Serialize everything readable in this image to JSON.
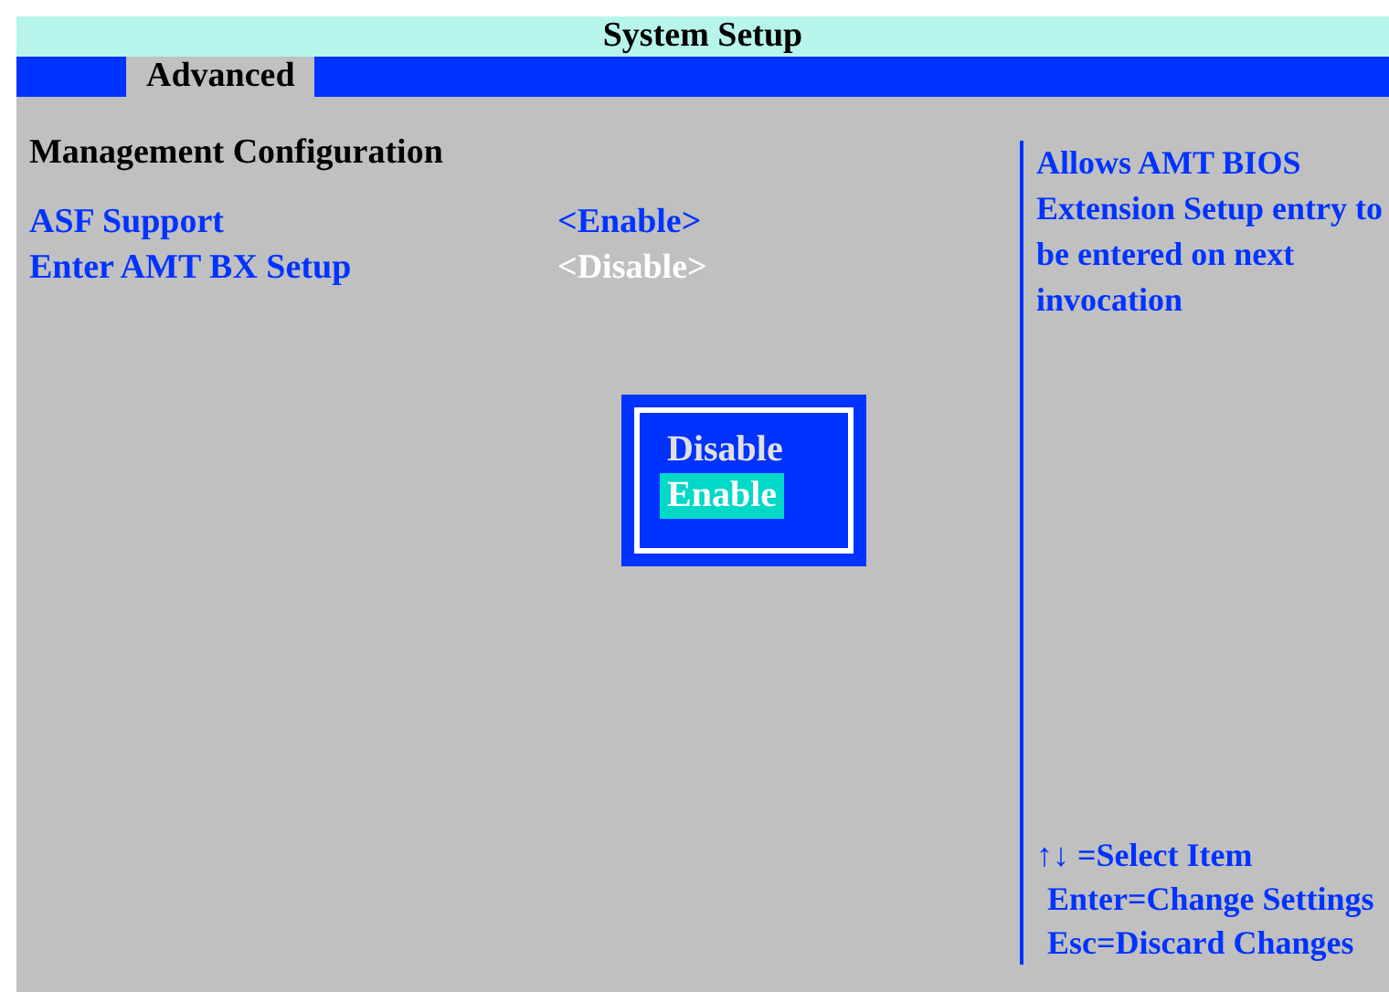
{
  "window": {
    "title": "System Setup"
  },
  "tabs": [
    {
      "label": "Advanced",
      "selected": true
    }
  ],
  "section": {
    "title": "Management Configuration"
  },
  "settings": [
    {
      "label": "ASF Support",
      "value": "<Enable>",
      "selected": false
    },
    {
      "label": "Enter AMT BX Setup",
      "value": "<Disable>",
      "selected": true
    }
  ],
  "popup": {
    "options": [
      {
        "label": "Disable",
        "selected": false
      },
      {
        "label": "Enable",
        "selected": true
      }
    ]
  },
  "help": {
    "text": "Allows AMT BIOS Extension Setup entry to be entered on next invocation"
  },
  "key_hints": [
    "↑↓ =Select Item",
    "Enter=Change Settings",
    "Esc=Discard Changes"
  ]
}
